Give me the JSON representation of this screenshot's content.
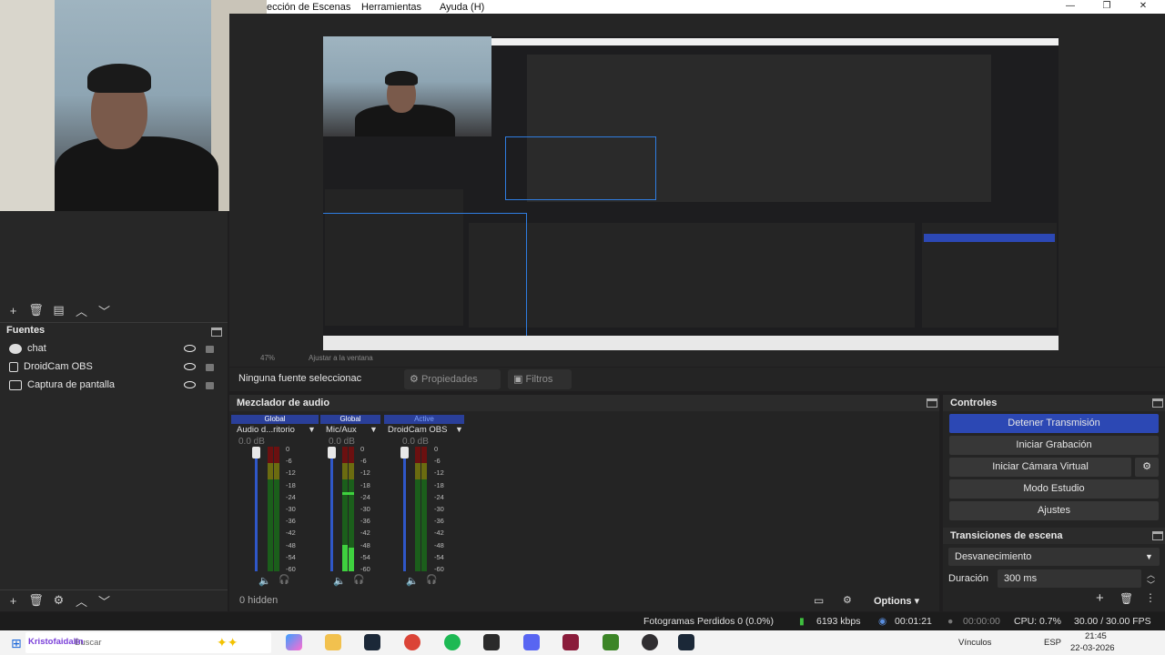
{
  "menu": {
    "items": [
      "ección de Escenas",
      "Herramientas",
      "Ayuda (H)"
    ]
  },
  "window_controls": {
    "minimize": "—",
    "restore": "❐",
    "close": "✕"
  },
  "preview": {
    "zoom": "47%",
    "fit_label": "Ajustar a la ventana"
  },
  "sources": {
    "title": "Fuentes",
    "items": [
      {
        "label": "chat",
        "icon": "globe-icon"
      },
      {
        "label": "DroidCam OBS",
        "icon": "camera-icon"
      },
      {
        "label": "Captura de pantalla",
        "icon": "monitor-icon"
      }
    ]
  },
  "properties_bar": {
    "no_source": "Ninguna fuente seleccionac",
    "properties_label": "Propiedades",
    "filters_label": "Filtros"
  },
  "mixer": {
    "title": "Mezclador de audio",
    "channels": [
      {
        "tag": "Global",
        "name": "Audio d...ritorio",
        "db": "0.0 dB",
        "level": 0
      },
      {
        "tag": "Global",
        "name": "Mic/Aux",
        "db": "0.0 dB",
        "level": 0.35
      },
      {
        "tag": "Active",
        "name": "DroidCam OBS",
        "db": "0.0 dB",
        "level": 0
      }
    ],
    "ticks": [
      "0",
      "-6",
      "-12",
      "-18",
      "-24",
      "-30",
      "-36",
      "-42",
      "-48",
      "-54",
      "-60"
    ],
    "hidden_label": "0 hidden",
    "options_label": "Options"
  },
  "controls": {
    "title": "Controles",
    "stop_stream": "Detener Transmisión",
    "start_recording": "Iniciar Grabación",
    "start_virtual_cam": "Iniciar Cámara Virtual",
    "studio_mode": "Modo Estudio",
    "settings": "Ajustes"
  },
  "transitions": {
    "title": "Transiciones de escena",
    "selected": "Desvanecimiento",
    "duration_label": "Duración",
    "duration_value": "300 ms"
  },
  "status": {
    "dropped_frames": "Fotogramas Perdidos 0 (0.0%)",
    "bitrate": "6193 kbps",
    "stream_time": "00:01:21",
    "record_time": "00:00:00",
    "cpu": "CPU: 0.7%",
    "fps": "30.00 / 30.00 FPS"
  },
  "taskbar": {
    "search_placeholder": "Buscar",
    "overlay_text": "Kristofaidalin",
    "links_label": "Vínculos",
    "language": "ESP",
    "time": "21:45",
    "date": "22-03-2026"
  },
  "colors": {
    "accent_blue": "#2c48b4",
    "meter_green": "#1b5e1b",
    "meter_active": "#3fd13f",
    "bitrate_green": "#3fbf3f"
  }
}
